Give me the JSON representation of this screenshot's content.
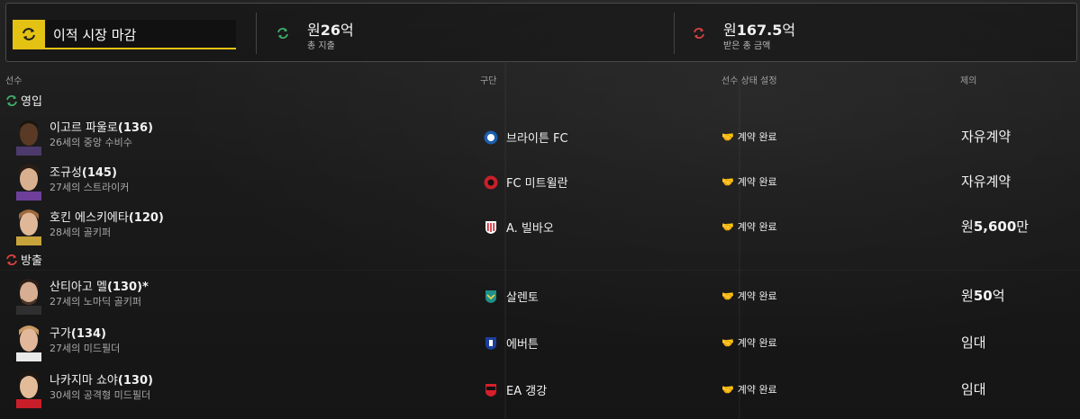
{
  "header": {
    "deadline_label": "이적 시장 마감",
    "spent": {
      "currency": "원",
      "amount": "26",
      "unit": "억",
      "label": "총 지출"
    },
    "received": {
      "currency": "원",
      "amount": "167.5",
      "unit": "억",
      "label": "받은 총 금액"
    }
  },
  "columns": {
    "player": "선수",
    "club": "구단",
    "status": "선수 상태 설정",
    "offer": "제의"
  },
  "sections": {
    "in": {
      "label": "영입",
      "rows": [
        {
          "name": "이고르 파울로",
          "rating": "(136)",
          "desc": "26세의 중앙 수비수",
          "club": "브라이튼 FC",
          "status": "계약 완료",
          "offer_prefix": "",
          "offer_bold": "",
          "offer_plain": "자유계약"
        },
        {
          "name": "조규성",
          "rating": "(145)",
          "desc": "27세의 스트라이커",
          "club": "FC 미트윌란",
          "status": "계약 완료",
          "offer_prefix": "",
          "offer_bold": "",
          "offer_plain": "자유계약"
        },
        {
          "name": "호킨 에스키에타",
          "rating": "(120)",
          "desc": "28세의 골키퍼",
          "club": "A. 빌바오",
          "status": "계약 완료",
          "offer_prefix": "원",
          "offer_bold": "5,600",
          "offer_plain": "만"
        }
      ]
    },
    "out": {
      "label": "방출",
      "rows": [
        {
          "name": "산티아고 멜",
          "rating": "(130)*",
          "desc": "27세의 노마딕 골키퍼",
          "club": "살렌토",
          "status": "계약 완료",
          "offer_prefix": "원",
          "offer_bold": "50",
          "offer_plain": "억"
        },
        {
          "name": "구가",
          "rating": "(134)",
          "desc": "27세의 미드필더",
          "club": "에버튼",
          "status": "계약 완료",
          "offer_prefix": "",
          "offer_bold": "",
          "offer_plain": "임대"
        },
        {
          "name": "나카지마 쇼야",
          "rating": "(130)",
          "desc": "30세의 공격형 미드필더",
          "club": "EA 갱강",
          "status": "계약 완료",
          "offer_prefix": "",
          "offer_bold": "",
          "offer_plain": "임대"
        }
      ]
    }
  },
  "colors": {
    "accent": "#e3c214",
    "in_arrow": "#3fae6a",
    "out_arrow": "#d94040"
  },
  "icons": {
    "deadline": "transfer-cycle-icon",
    "in": "incoming-cycle-icon",
    "out": "outgoing-cycle-icon",
    "status": "handshake-icon"
  }
}
